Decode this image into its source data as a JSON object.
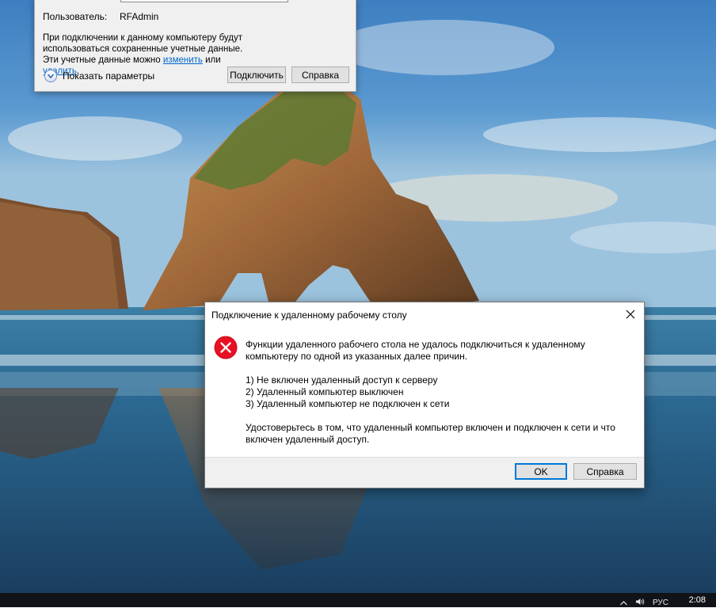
{
  "rdp_window": {
    "user_label": "Пользователь:",
    "user_value": "RFAdmin",
    "info_text": "При подключении к данному компьютеру будут использоваться сохраненные учетные данные. Эти учетные данные можно",
    "link_edit": "изменить",
    "or_text": "или",
    "link_delete": "удалить",
    "period": ".",
    "show_options": "Показать параметры",
    "connect_button": "Подключить",
    "help_button": "Справка"
  },
  "dialog": {
    "title": "Подключение к удаленному рабочему столу",
    "message_intro": "Функции удаленного рабочего стола не удалось подключиться к удаленному компьютеру по одной из указанных далее причин.",
    "reasons": [
      "1) Не включен удаленный доступ к серверу",
      "2) Удаленный компьютер выключен",
      "3) Удаленный компьютер не подключен к сети"
    ],
    "message_advice": "Удостоверьтесь в том, что удаленный компьютер включен и подключен к сети и что включен удаленный доступ.",
    "ok_button": "OK",
    "help_button": "Справка",
    "icon": "error-icon",
    "icon_color": "#e81123"
  },
  "taskbar": {
    "language": "РУС",
    "time": "2:08"
  },
  "colors": {
    "accent": "#0078d7",
    "link": "#0066cc",
    "taskbar": "#101418"
  }
}
